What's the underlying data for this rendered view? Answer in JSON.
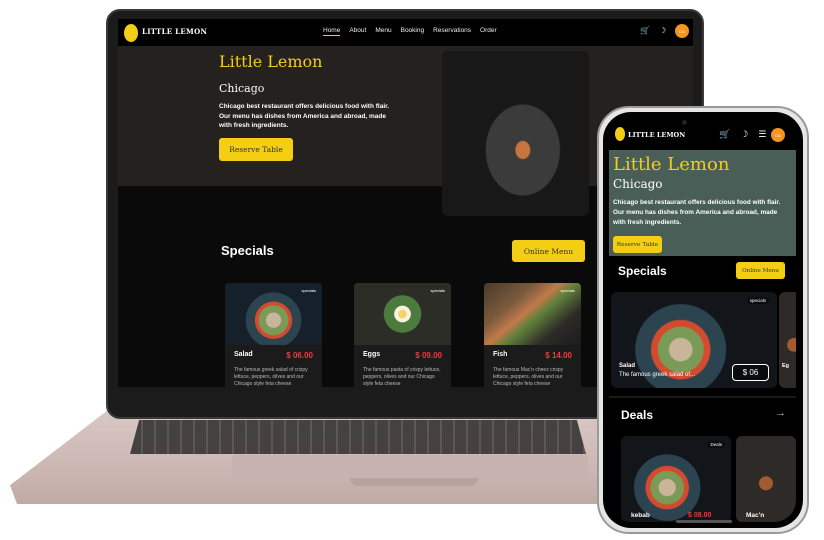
{
  "brand": "LITTLE LEMON",
  "nav": {
    "items": [
      "Home",
      "About",
      "Menu",
      "Booking",
      "Reservations",
      "Order"
    ],
    "avatar": "DA"
  },
  "hero": {
    "title": "Little Lemon",
    "subtitle": "Chicago",
    "description": "Chicago best restaurant offers delicious food with flair. Our menu has dishes from America and abroad, made with fresh ingredients.",
    "reserve_label": "Reserve Table"
  },
  "specials": {
    "title": "Specials",
    "online_menu_label": "Online Menu",
    "tag": "specials",
    "cards": [
      {
        "name": "Salad",
        "price": "$ 06.00",
        "description": "The famous greek salad of crispy lettuce, peppers, olives and our Chicago style feta cheese"
      },
      {
        "name": "Eggs",
        "price": "$ 09.00",
        "description": "The famous pasta of crispy lettuce, peppers, olives and our Chicago style feta cheese"
      },
      {
        "name": "Fish",
        "price": "$ 14.00",
        "description": "The famous Mac'n cheez crispy lettuce, peppers, olives and our Chicago style feta cheese"
      }
    ]
  },
  "mobile": {
    "special_card": {
      "tag": "specials",
      "name": "Salad",
      "description": "The famous greek salad of...",
      "price": "$ 06",
      "next_label": "Eg"
    },
    "deals": {
      "title": "Deals",
      "arrow": "→",
      "tag": "Deals",
      "cards": [
        {
          "name": "kebab",
          "price": "$ 08.00"
        },
        {
          "name": "Mac'n"
        }
      ]
    }
  },
  "colors": {
    "accent": "#f4ce14",
    "hero_green": "#495e57",
    "price_red": "#ee3b3b",
    "avatar_orange": "#f7941d"
  }
}
